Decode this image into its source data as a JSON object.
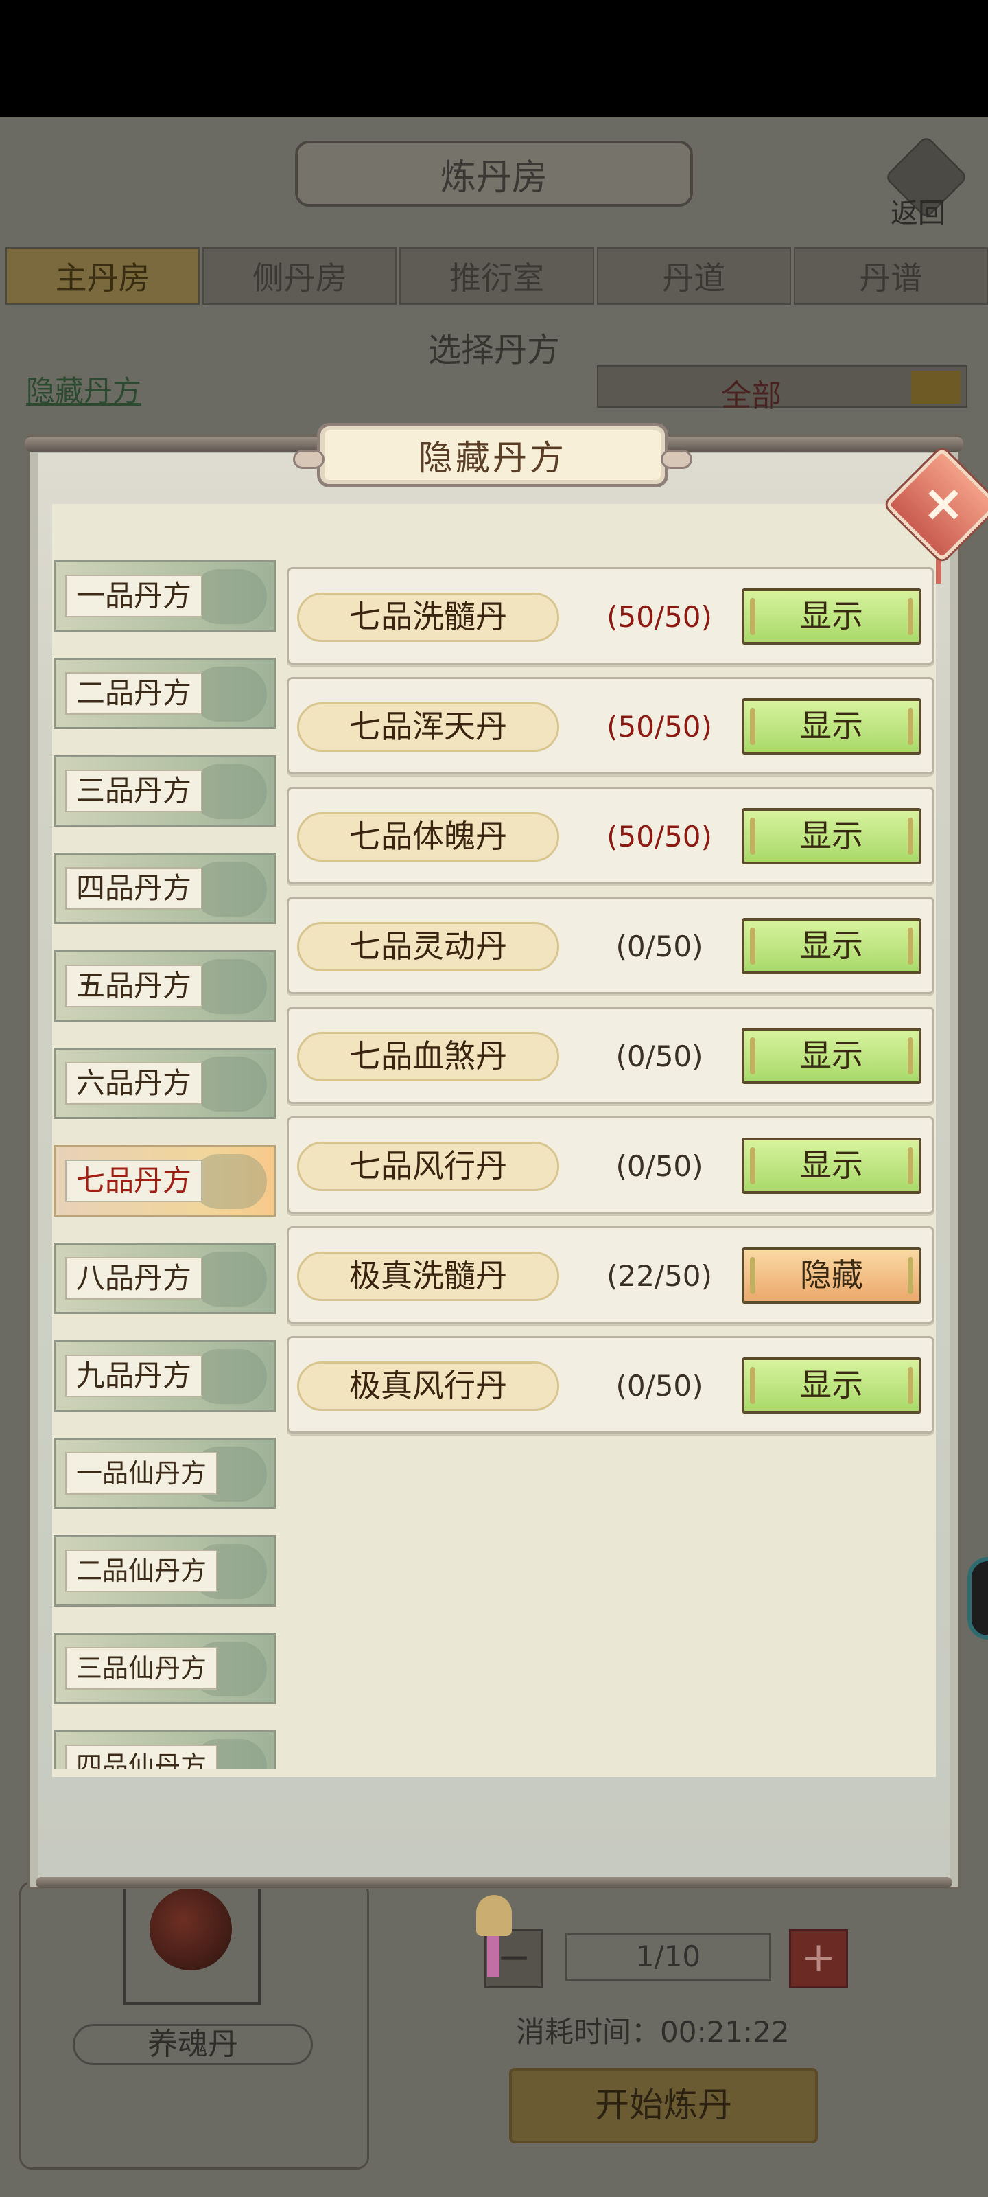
{
  "app": {
    "title": "炼丹房",
    "back_label": "返回",
    "tabs": [
      "主丹房",
      "侧丹房",
      "推衍室",
      "丹道",
      "丹谱"
    ],
    "active_tab": 0,
    "section_header": "选择丹方",
    "hidden_recipes_link": "隐藏丹方",
    "filter_dropdown": "全部",
    "selected_item": "养魂丹",
    "quantity": "1/10",
    "time_label": "消耗时间：00:21:22",
    "start_button": "开始炼丹"
  },
  "modal": {
    "title": "隐藏丹方",
    "close_icon": "×",
    "categories": [
      "一品丹方",
      "二品丹方",
      "三品丹方",
      "四品丹方",
      "五品丹方",
      "六品丹方",
      "七品丹方",
      "八品丹方",
      "九品丹方",
      "一品仙丹方",
      "二品仙丹方",
      "三品仙丹方",
      "四品仙丹方"
    ],
    "active_category": 6,
    "recipes": [
      {
        "name": "七品洗髓丹",
        "count": "(50/50)",
        "full": true,
        "action": "显示"
      },
      {
        "name": "七品浑天丹",
        "count": "(50/50)",
        "full": true,
        "action": "显示"
      },
      {
        "name": "七品体魄丹",
        "count": "(50/50)",
        "full": true,
        "action": "显示"
      },
      {
        "name": "七品灵动丹",
        "count": "(0/50)",
        "full": false,
        "action": "显示"
      },
      {
        "name": "七品血煞丹",
        "count": "(0/50)",
        "full": false,
        "action": "显示"
      },
      {
        "name": "七品风行丹",
        "count": "(0/50)",
        "full": false,
        "action": "显示"
      },
      {
        "name": "极真洗髓丹",
        "count": "(22/50)",
        "full": false,
        "action": "隐藏"
      },
      {
        "name": "极真风行丹",
        "count": "(0/50)",
        "full": false,
        "action": "显示"
      }
    ]
  },
  "colors": {
    "show_button": "#b8e27c",
    "hide_button": "#f2bf83",
    "full_count": "#8c1a12",
    "active_category_text": "#a01f14"
  }
}
